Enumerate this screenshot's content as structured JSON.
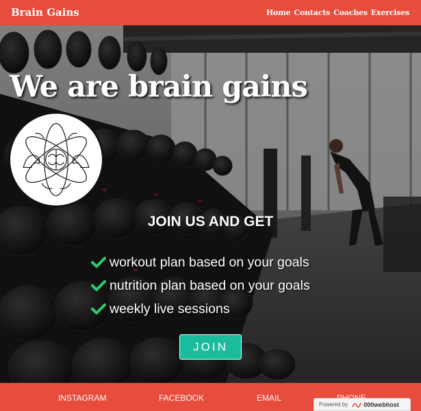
{
  "header": {
    "brand": "Brain Gains",
    "nav": [
      "Home",
      "Contacts",
      "Coaches",
      "Exercises"
    ]
  },
  "hero": {
    "headline": "We are brain gains",
    "logo_icon": "brain-gains-logo-icon",
    "join_title": "JOIN US AND GET",
    "benefits": [
      "workout plan based on your goals",
      "nutrition plan based on your goals",
      "weekly live sessions"
    ],
    "check_icon": "check-icon",
    "join_button": "JOIN"
  },
  "footer": {
    "links": [
      "INSTAGRAM",
      "FACEBOOK",
      "EMAIL",
      "PHONE"
    ]
  },
  "badge": {
    "powered_by": "Powered by",
    "host": "000webhost"
  },
  "colors": {
    "brand_red": "#e74c3c",
    "accent_teal": "#1abc9c",
    "check_green": "#2ecc71"
  }
}
